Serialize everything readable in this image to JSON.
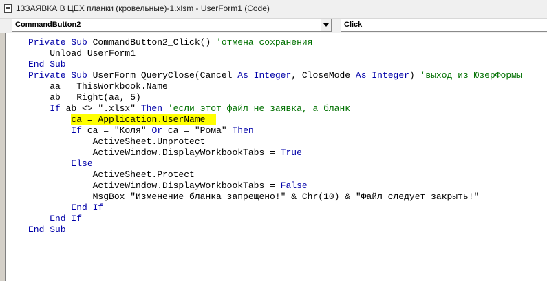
{
  "window": {
    "title": "13ЗАЯВКА В ЦЕХ планки (кровельные)-1.xlsm - UserForm1 (Code)"
  },
  "toolbar": {
    "object_combo": "CommandButton2",
    "procedure_combo": "Click"
  },
  "code": {
    "l1": {
      "a": "Private Sub ",
      "b": "CommandButton2_Click() ",
      "c": "'отмена сохранения"
    },
    "l2": {
      "a": "    Unload UserForm1"
    },
    "l3": {
      "a": "End Sub"
    },
    "l4": {
      "a": "Private Sub ",
      "b": "UserForm_QueryClose(Cancel ",
      "c": "As Integer",
      "d": ", CloseMode ",
      "e": "As Integer",
      "f": ") ",
      "g": "'выход из ЮзерФормы"
    },
    "l5": {
      "a": "    aa = ThisWorkbook.Name"
    },
    "l6": {
      "a": "    ab = Right(aa, 5)"
    },
    "l7": {
      "a": "    If ",
      "b": "ab <> \".xlsx\" ",
      "c": "Then ",
      "d": "'если этот файл не заявка, а бланк"
    },
    "l8": {
      "a": "ca = Application.UserName  "
    },
    "l9": {
      "a": "        If ",
      "b": "ca = \"Коля\" ",
      "c": "Or ",
      "d": "ca = \"Рома\" ",
      "e": "Then"
    },
    "l10": {
      "a": "            ActiveSheet.Unprotect"
    },
    "l11": {
      "a": "            ActiveWindow.DisplayWorkbookTabs = ",
      "b": "True"
    },
    "l12": {
      "a": "        Else"
    },
    "l13": {
      "a": "            ActiveSheet.Protect"
    },
    "l14": {
      "a": "            ActiveWindow.DisplayWorkbookTabs = ",
      "b": "False"
    },
    "l15": {
      "a": "            MsgBox \"Изменение бланка запрещено!\" & Chr(10) & \"Файл следует закрыть!\""
    },
    "l16": {
      "a": "        End If"
    },
    "l17": {
      "a": "    End If"
    },
    "l18": {
      "a": "End Sub"
    }
  },
  "colors": {
    "keyword": "#0000a8",
    "comment": "#007000",
    "highlight": "#ffff00"
  }
}
